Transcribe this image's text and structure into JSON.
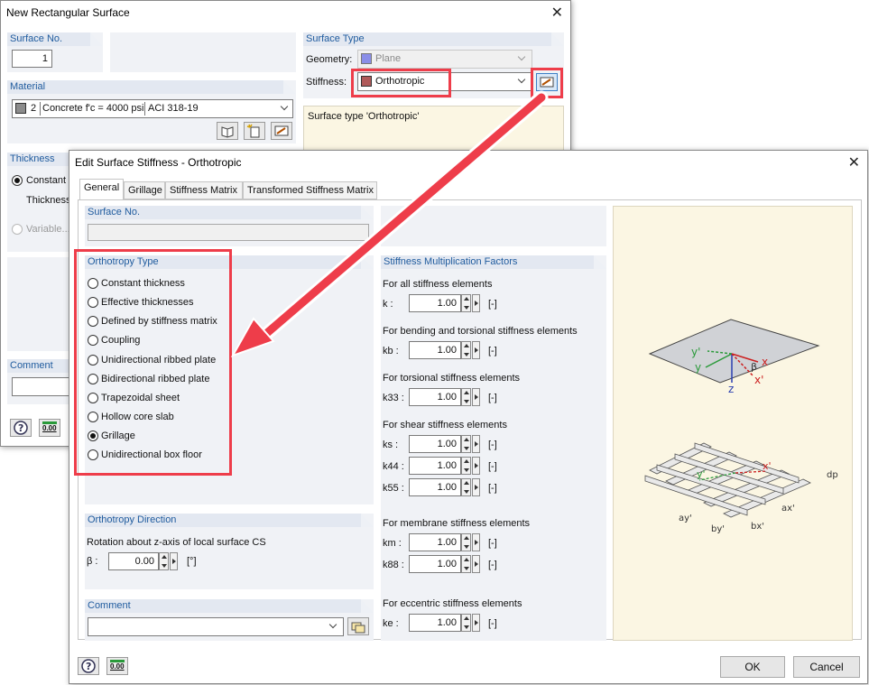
{
  "back_dialog": {
    "title": "New Rectangular Surface",
    "surface_no": {
      "header": "Surface No.",
      "value": "1"
    },
    "material": {
      "header": "Material",
      "number": "2",
      "name": "Concrete f'c = 4000 psi",
      "standard": "ACI 318-19"
    },
    "thickness": {
      "header": "Thickness",
      "constant": "Constant",
      "thickness_label": "Thickness",
      "variable": "Variable..."
    },
    "comment": {
      "header": "Comment"
    },
    "surface_type": {
      "header": "Surface Type",
      "geometry_label": "Geometry:",
      "geometry_value": "Plane",
      "stiffness_label": "Stiffness:",
      "stiffness_value": "Orthotropic",
      "description": "Surface type 'Orthotropic'"
    },
    "status_value": "0.00"
  },
  "front_dialog": {
    "title": "Edit Surface Stiffness - Orthotropic",
    "tabs": [
      "General",
      "Grillage",
      "Stiffness Matrix",
      "Transformed Stiffness Matrix"
    ],
    "surface_no": {
      "header": "Surface No."
    },
    "orthotropy_type": {
      "header": "Orthotropy Type",
      "options": [
        "Constant thickness",
        "Effective thicknesses",
        "Defined by stiffness matrix",
        "Coupling",
        "Unidirectional ribbed plate",
        "Bidirectional ribbed plate",
        "Trapezoidal sheet",
        "Hollow core slab",
        "Grillage",
        "Unidirectional box floor"
      ],
      "selected": "Grillage"
    },
    "orthotropy_direction": {
      "header": "Orthotropy Direction",
      "rotation_label": "Rotation about z-axis of local surface CS",
      "beta_label": "β :",
      "beta_value": "0.00",
      "beta_unit": "[°]"
    },
    "comment": {
      "header": "Comment"
    },
    "factors": {
      "header": "Stiffness Multiplication Factors",
      "groups": [
        {
          "title": "For all stiffness elements",
          "rows": [
            {
              "label": "k :",
              "value": "1.00",
              "unit": "[-]"
            }
          ]
        },
        {
          "title": "For bending and torsional stiffness elements",
          "rows": [
            {
              "label": "kb :",
              "value": "1.00",
              "unit": "[-]"
            }
          ]
        },
        {
          "title": "For torsional stiffness elements",
          "rows": [
            {
              "label": "k33 :",
              "value": "1.00",
              "unit": "[-]"
            }
          ]
        },
        {
          "title": "For shear stiffness elements",
          "rows": [
            {
              "label": "ks :",
              "value": "1.00",
              "unit": "[-]"
            },
            {
              "label": "k44 :",
              "value": "1.00",
              "unit": "[-]"
            },
            {
              "label": "k55 :",
              "value": "1.00",
              "unit": "[-]"
            }
          ]
        },
        {
          "title": "For membrane stiffness elements",
          "rows": [
            {
              "label": "km :",
              "value": "1.00",
              "unit": "[-]"
            },
            {
              "label": "k88 :",
              "value": "1.00",
              "unit": "[-]"
            }
          ]
        },
        {
          "title": "For eccentric stiffness elements",
          "rows": [
            {
              "label": "ke :",
              "value": "1.00",
              "unit": "[-]"
            }
          ]
        }
      ]
    },
    "diagram": {
      "plate_labels": [
        "y'",
        "y",
        "z",
        "β",
        "x",
        "x'"
      ],
      "grid_labels": [
        "y'",
        "x'",
        "dp",
        "ay'",
        "by'",
        "bx'",
        "ax'"
      ]
    },
    "buttons": {
      "ok": "OK",
      "cancel": "Cancel"
    },
    "status_value": "0.00"
  },
  "colors": {
    "accent_red": "#ee3d4a",
    "header_blue": "#1f5b9e",
    "panel_bg": "#f0f2f6",
    "diagram_bg": "#fbf6e3"
  }
}
